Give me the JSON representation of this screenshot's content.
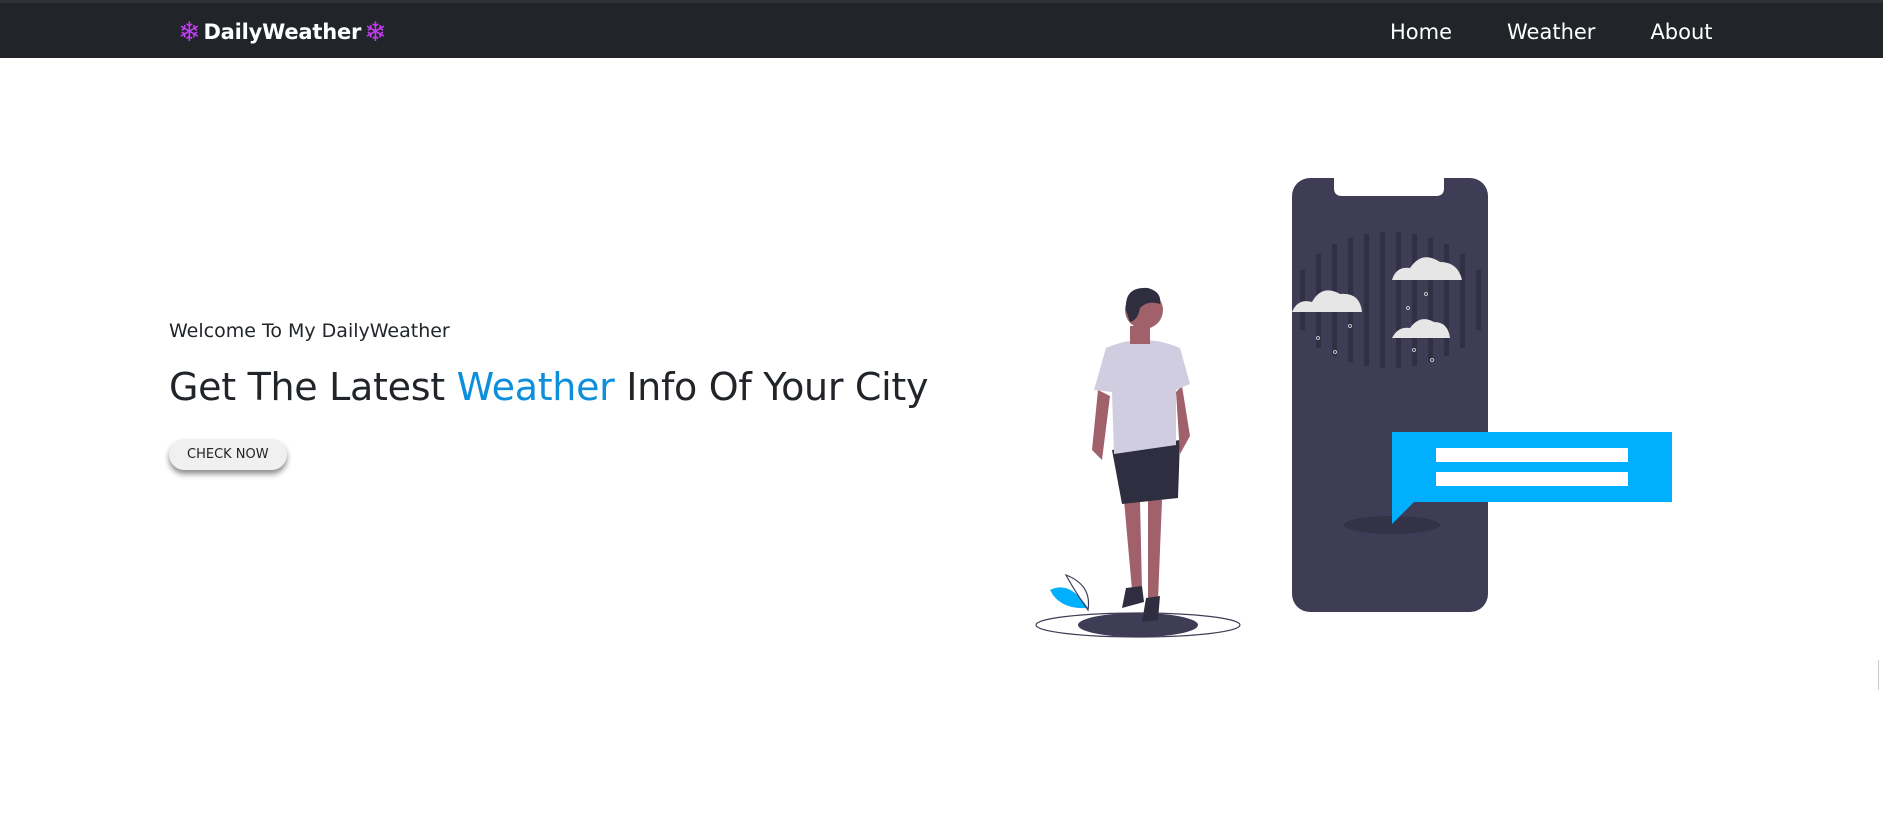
{
  "navbar": {
    "brand": "DailyWeather",
    "brand_icon": "snowflake-icon",
    "brand_icon_color": "#c43cf3",
    "background": "#212529",
    "links": [
      {
        "label": "Home"
      },
      {
        "label": "Weather"
      },
      {
        "label": "About"
      }
    ]
  },
  "hero": {
    "welcome": "Welcome To My DailyWeather",
    "headline_before": "Get The Latest ",
    "headline_accent": "Weather",
    "headline_after": " Info Of Your City",
    "accent_color": "#0d8fdb",
    "button_label": "CHECK NOW"
  },
  "illustration": {
    "subject": "person-standing-next-to-phone-with-weather-icon",
    "primary_color": "#3f3d56",
    "highlight_color": "#00b0ff"
  }
}
